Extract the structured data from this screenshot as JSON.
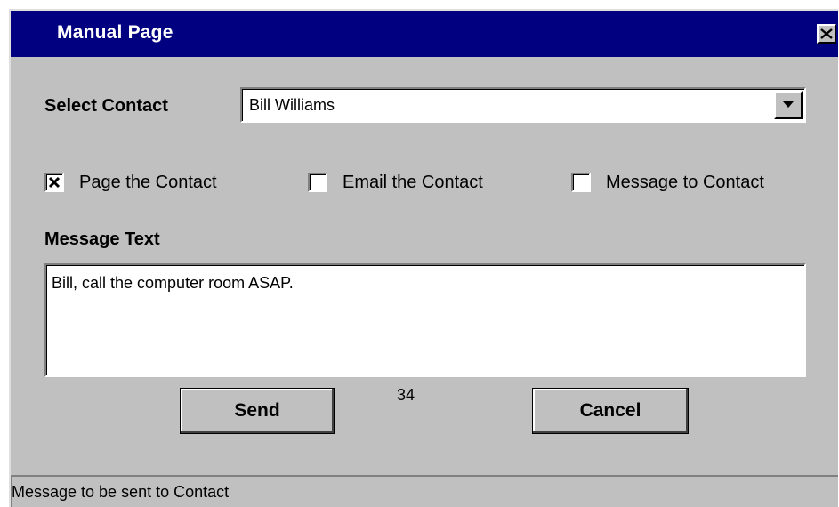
{
  "window": {
    "title": "Manual Page",
    "close_icon": "close-icon"
  },
  "contact": {
    "label": "Select Contact",
    "selected": "Bill Williams",
    "dropdown_icon": "chevron-down-icon"
  },
  "options": [
    {
      "label": "Page the Contact",
      "checked": true
    },
    {
      "label": "Email the Contact",
      "checked": false
    },
    {
      "label": "Message to Contact",
      "checked": false
    }
  ],
  "message": {
    "label": "Message Text",
    "value": "Bill, call the computer room ASAP.",
    "char_count": "34"
  },
  "buttons": {
    "send": "Send",
    "cancel": "Cancel"
  },
  "status": {
    "text": "Message to be sent to Contact"
  },
  "colors": {
    "titlebar": "#000080",
    "face": "#c0c0c0",
    "title_text": "#ffffff"
  }
}
